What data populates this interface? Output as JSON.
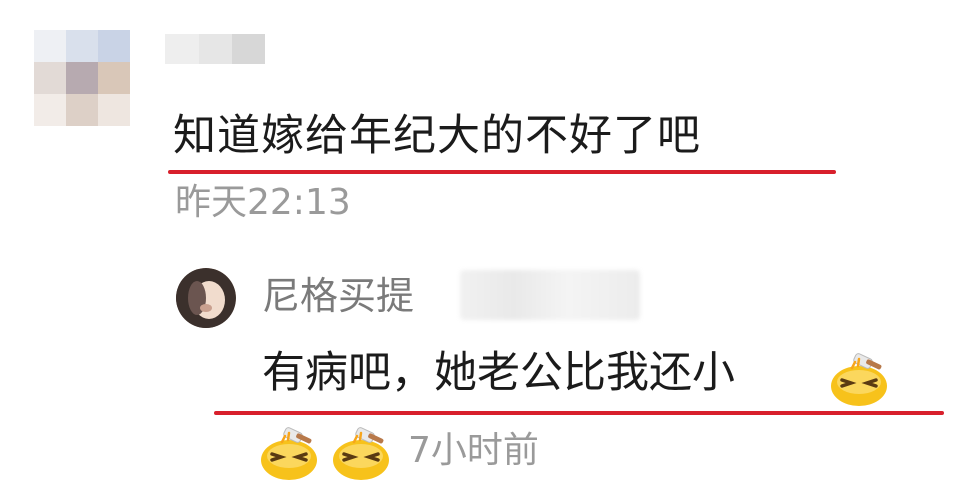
{
  "comment": {
    "text": "知道嫁给年纪大的不好了吧",
    "time": "昨天22:13"
  },
  "reply": {
    "author": "尼格买提",
    "text": "有病吧，她老公比我还小",
    "time": "7小时前",
    "emoji_name": "facepalm-emoji"
  },
  "colors": {
    "underline": "#d8202c",
    "text_primary": "#1b1b1b",
    "text_secondary": "#9a9a9a"
  }
}
